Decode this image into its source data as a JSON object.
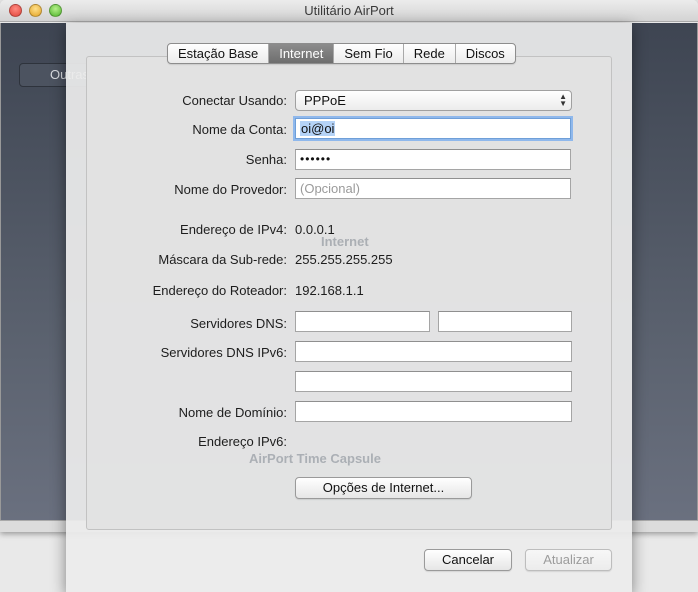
{
  "window": {
    "title": "Utilitário AirPort"
  },
  "background": {
    "other_button_label": "Outras"
  },
  "ghost_text": {
    "internet": "Internet",
    "device": "AirPort Time Capsule"
  },
  "tabs": [
    {
      "label": "Estação Base",
      "active": false
    },
    {
      "label": "Internet",
      "active": true
    },
    {
      "label": "Sem Fio",
      "active": false
    },
    {
      "label": "Rede",
      "active": false
    },
    {
      "label": "Discos",
      "active": false
    }
  ],
  "form": {
    "connect_label": "Conectar Usando:",
    "connect_value": "PPPoE",
    "account_label": "Nome da Conta:",
    "account_value": "oi@oi",
    "password_label": "Senha:",
    "password_value": "••••••",
    "provider_label": "Nome do Provedor:",
    "provider_placeholder": "(Opcional)",
    "ipv4_label": "Endereço de IPv4:",
    "ipv4_value": "0.0.0.1",
    "subnet_label": "Máscara da Sub-rede:",
    "subnet_value": "255.255.255.255",
    "router_label": "Endereço do Roteador:",
    "router_value": "192.168.1.1",
    "dns_label": "Servidores DNS:",
    "dns1_value": "",
    "dns2_value": "",
    "dns6_label": "Servidores DNS IPv6:",
    "dns6_1_value": "",
    "dns6_2_value": "",
    "domain_label": "Nome de Domínio:",
    "domain_value": "",
    "ipv6_label": "Endereço IPv6:",
    "ipv6_value": "",
    "internet_options_button": "Opções de Internet..."
  },
  "footer": {
    "cancel_button": "Cancelar",
    "update_button": "Atualizar"
  }
}
